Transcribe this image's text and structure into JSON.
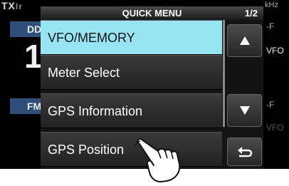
{
  "background": {
    "tx_label": "TX",
    "left_frag1": "DD",
    "left_big": "1",
    "left_frag2": "FM",
    "right_unit": "kHz",
    "right_frag1": "-F",
    "right_frag2": "VFO",
    "right_frag3": "-F",
    "right_frag4": "VFO"
  },
  "menu": {
    "title": "QUICK MENU",
    "page": "1/2",
    "items": [
      {
        "label": "VFO/MEMORY",
        "selected": true
      },
      {
        "label": "Meter Select",
        "selected": false
      },
      {
        "label": "GPS Information",
        "selected": false
      },
      {
        "label": "GPS Position",
        "selected": false
      }
    ],
    "buttons": {
      "up_icon": "triangle-up-icon",
      "down_icon": "triangle-down-icon",
      "back_icon": "return-arrow-icon"
    }
  },
  "colors": {
    "selected_bg": "#97e4f2",
    "menu_bg": "#141414",
    "screen_bg": "#000000"
  },
  "pointer": {
    "icon": "pointing-hand-icon"
  }
}
